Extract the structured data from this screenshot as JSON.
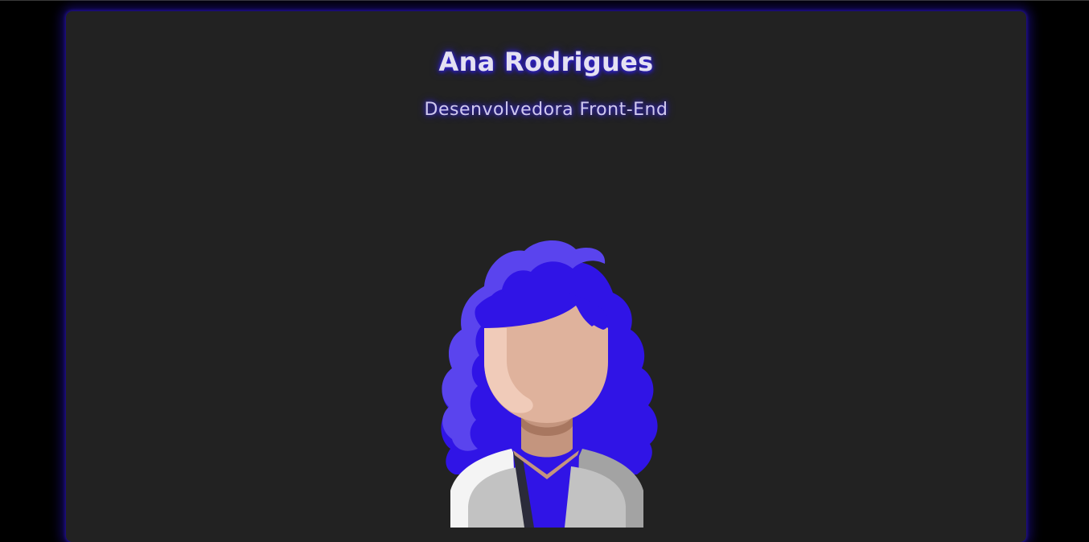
{
  "profile": {
    "name": "Ana Rodrigues",
    "role": "Desenvolvedora Front-End",
    "avatar_icon": "developer-woman-avatar-icon"
  },
  "colors": {
    "background": "#000000",
    "card": "#222222",
    "glow": "#2a1cd6",
    "hair_dark": "#3014e6",
    "hair_light": "#5a44ee",
    "skin": "#dfb29c",
    "skin_light": "#f0cbb9",
    "neck": "#c4957e",
    "shirt": "#3014e6",
    "jacket_light": "#c2c2c2",
    "jacket_dark": "#a3a3a3"
  }
}
